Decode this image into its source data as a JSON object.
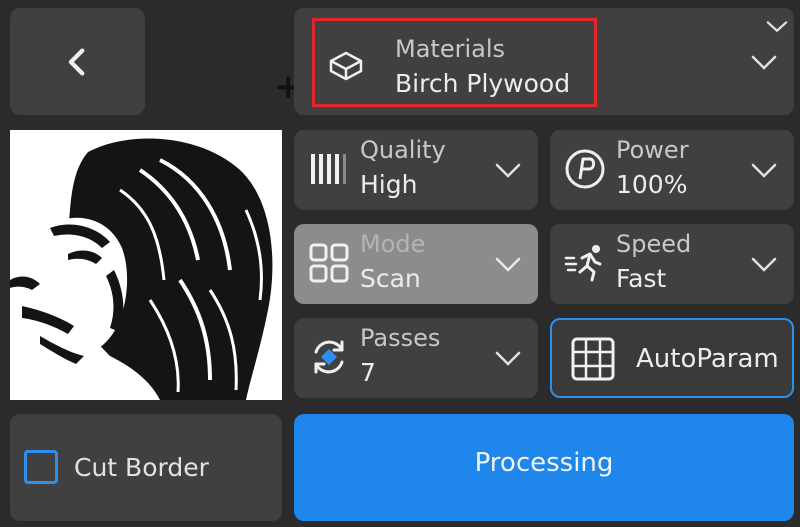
{
  "nav": {
    "back_icon": "chevron-left-icon",
    "add_icon": "plus-icon",
    "collapse_icon": "chevron-down-icon"
  },
  "materials": {
    "label": "Materials",
    "value": "Birch Plywood",
    "icon": "material-box-icon"
  },
  "preview": {
    "image": "lion-head-engraving"
  },
  "settings": {
    "quality": {
      "label": "Quality",
      "value": "High",
      "icon": "quality-bars-icon"
    },
    "power": {
      "label": "Power",
      "value": "100%",
      "icon": "power-icon"
    },
    "mode": {
      "label": "Mode",
      "value": "Scan",
      "icon": "grid-mode-icon"
    },
    "speed": {
      "label": "Speed",
      "value": "Fast",
      "icon": "speed-runner-icon"
    },
    "passes": {
      "label": "Passes",
      "value": "7",
      "icon": "passes-cycle-icon"
    }
  },
  "autoparam": {
    "label": "AutoParam",
    "icon": "grid-icon"
  },
  "cut_border": {
    "label": "Cut Border",
    "checked": false
  },
  "actions": {
    "processing_label": "Processing"
  },
  "colors": {
    "accent": "#1f86ec",
    "highlight": "#e0262a",
    "panel": "#404040",
    "background": "#2b2b2b"
  }
}
